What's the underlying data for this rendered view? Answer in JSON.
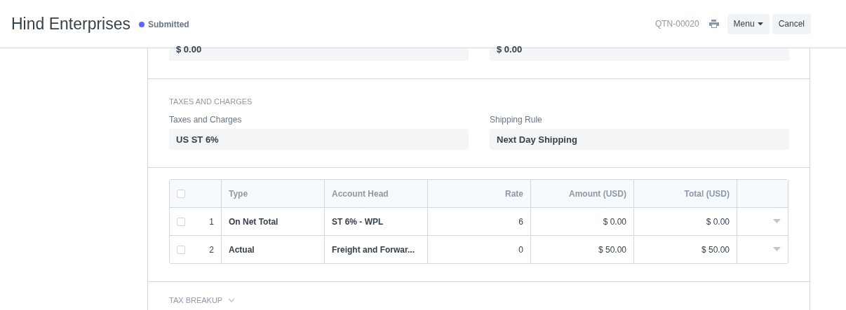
{
  "header": {
    "title": "Hind Enterprises",
    "status": {
      "label": "Submitted",
      "color": "#5e64ff"
    },
    "doc_id": "QTN-00020",
    "buttons": [
      "Menu",
      "Cancel"
    ]
  },
  "top_fields": [
    {
      "value": "$ 0.00"
    },
    {
      "value": "$ 0.00"
    }
  ],
  "taxes_section": {
    "heading": "TAXES AND CHARGES",
    "fields": [
      {
        "label": "Taxes and Charges",
        "value": "US ST 6%"
      },
      {
        "label": "Shipping Rule",
        "value": "Next Day Shipping"
      }
    ]
  },
  "table": {
    "select_all_checked": false,
    "columns": [
      {
        "label": "Type",
        "numeric": false
      },
      {
        "label": "Account Head",
        "numeric": false
      },
      {
        "label": "Rate",
        "numeric": true
      },
      {
        "label": "Amount (USD)",
        "numeric": true
      },
      {
        "label": "Total (USD)",
        "numeric": true
      }
    ],
    "rows": [
      {
        "checked": false,
        "index": "1",
        "cells": [
          "On Net Total",
          "ST 6% - WPL",
          "6",
          "$ 0.00",
          "$ 0.00"
        ]
      },
      {
        "checked": false,
        "index": "2",
        "cells": [
          "Actual",
          "Freight and Forwar...",
          "0",
          "$ 50.00",
          "$ 50.00"
        ]
      }
    ]
  },
  "tax_breakup": {
    "heading": "TAX BREAKUP",
    "expanded": false
  }
}
